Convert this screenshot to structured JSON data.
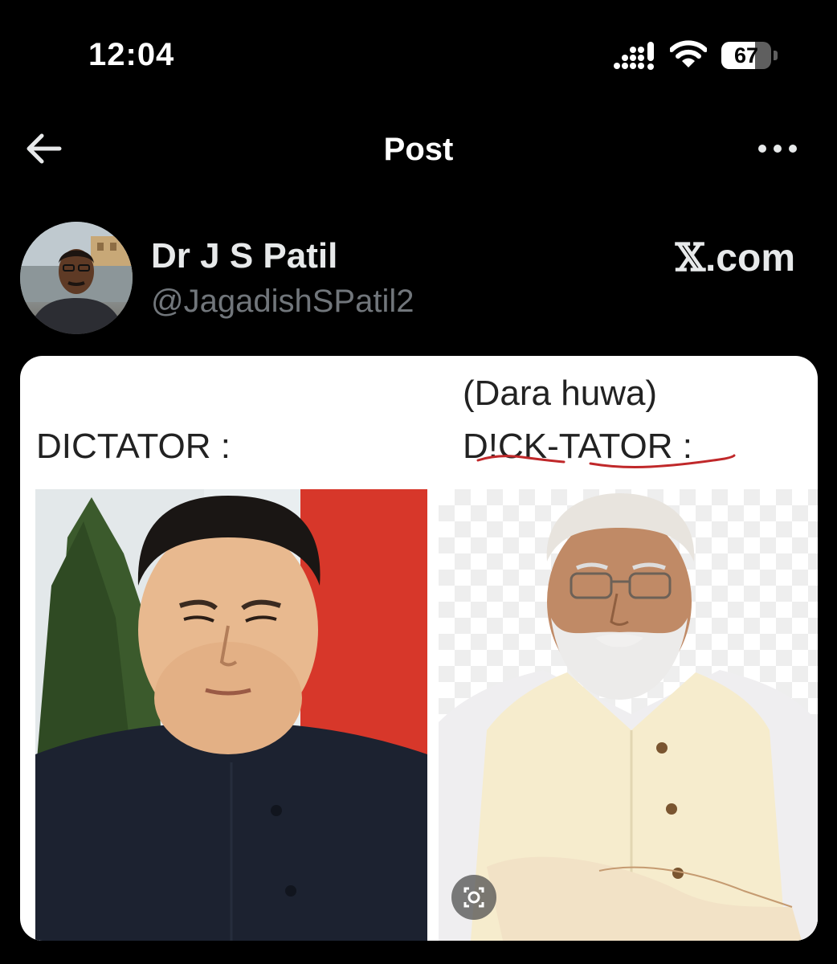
{
  "status_bar": {
    "time": "12:04",
    "signal_icon": "cellular-signal-icon",
    "wifi_icon": "wifi-icon",
    "battery_level": "67",
    "battery_fraction": 0.67
  },
  "nav": {
    "back_icon": "arrow-left-icon",
    "title": "Post",
    "more_icon": "more-horizontal-icon"
  },
  "post": {
    "author_name": "Dr J S Patil",
    "author_handle": "@JagadishSPatil2",
    "source_x": "𝕏",
    "source_domain": ".com",
    "image": {
      "caption_left": "DICTATOR :",
      "caption_right_sub": "(Dara huwa)",
      "caption_right": "D!CK-TATOR :",
      "lens_icon": "visual-search-icon"
    }
  },
  "colors": {
    "background": "#000000",
    "primary_text": "#e7e9ea",
    "secondary_text": "#71767b",
    "annotation_red": "#c0282a"
  }
}
